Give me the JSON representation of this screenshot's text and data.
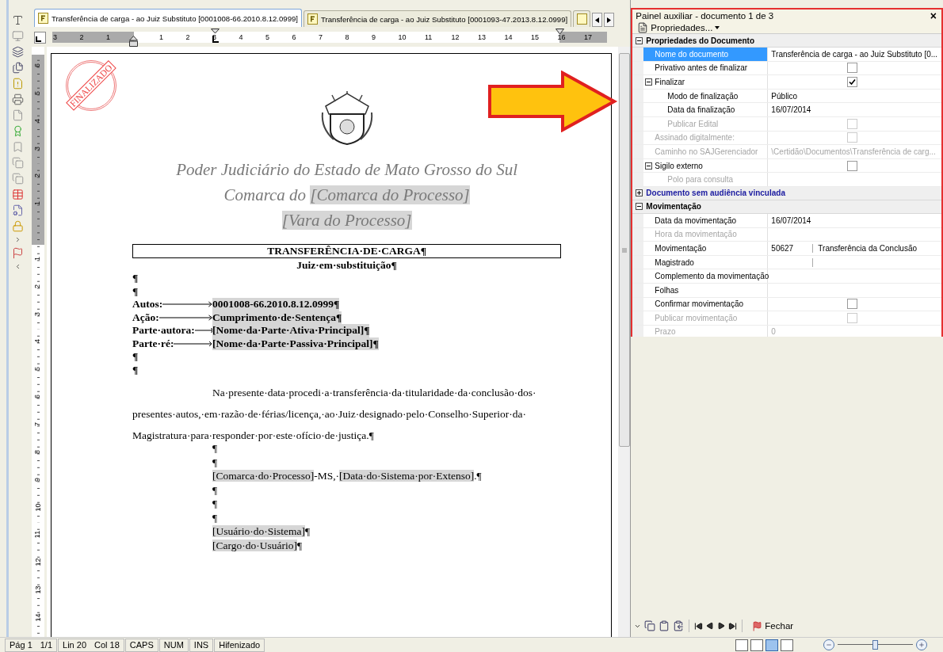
{
  "tabs": [
    {
      "label": "Transferência de carga - ao Juiz Substituto [0001008-66.2010.8.12.0999]",
      "selected": true
    },
    {
      "label": "Transferência de carga - ao Juiz Substituto [0001093-47.2013.8.12.0999]",
      "selected": false
    }
  ],
  "ruler": {
    "left_labels": [
      "3",
      "2",
      "1"
    ],
    "right_labels": [
      "1",
      "2",
      "3",
      "4",
      "5",
      "6",
      "7",
      "8",
      "9",
      "10",
      "11",
      "12",
      "13",
      "14",
      "15",
      "16",
      "17"
    ]
  },
  "vertical_ruler": {
    "upper_labels": [
      "6",
      "5",
      "4",
      "3",
      "2",
      "1"
    ],
    "lower_labels": [
      "1",
      "2",
      "3",
      "4",
      "5",
      "6",
      "7",
      "8",
      "9",
      "10",
      "11",
      "12",
      "13",
      "14"
    ]
  },
  "document": {
    "stamp": "FINALIZADO",
    "header": [
      [
        {
          "text": "Poder Judiciário do Estado de Mato Grosso do Sul",
          "field": false
        }
      ],
      [
        {
          "text": "Comarca do ",
          "field": false
        },
        {
          "text": "[Comarca do Processo]",
          "field": true
        }
      ],
      [
        {
          "text": "[Vara do Processo]",
          "field": true
        }
      ]
    ],
    "title": "TRANSFERÊNCIA·DE·CARGA¶",
    "subtitle": "Juiz·em·substituição¶",
    "marks_before": [
      "¶",
      "¶"
    ],
    "fields": [
      {
        "label": "Autos:",
        "value": "0001008-66.2010.8.12.0999¶"
      },
      {
        "label": "Ação:",
        "value": "Cumprimento·de·Sentença¶"
      },
      {
        "label": "Parte·autora:",
        "value": "[Nome·da·Parte·Ativa·Principal]¶"
      },
      {
        "label": "Parte·ré:",
        "value": "[Nome·da·Parte·Passiva·Principal]¶"
      }
    ],
    "marks_after": [
      "¶",
      "¶"
    ],
    "paragraph": [
      "Na·presente·data·procedi·a·transferência·da·titularidade·da·conclusão·dos·",
      "presentes·autos,·em·razão·de·férias/licença,·ao·Juiz·designado·pelo·Conselho·Superior·da·",
      "Magistratura·para·responder·por·este·ofício·de·justiça.¶"
    ],
    "closing": [
      [
        {
          "text": "¶",
          "field": false
        }
      ],
      [
        {
          "text": "¶",
          "field": false
        }
      ],
      [
        {
          "text": "[Comarca·do·Processo]",
          "field": true
        },
        {
          "text": "-MS,·",
          "field": false
        },
        {
          "text": "[Data·do·Sistema·por·Extenso]",
          "field": true
        },
        {
          "text": ".¶",
          "field": false
        }
      ],
      [
        {
          "text": "¶",
          "field": false
        }
      ],
      [
        {
          "text": "¶",
          "field": false
        }
      ],
      [
        {
          "text": "¶",
          "field": false
        }
      ],
      [
        {
          "text": "[Usuário·do·Sistema]",
          "field": true
        },
        {
          "text": "¶",
          "field": false
        }
      ],
      [
        {
          "text": "[Cargo·do·Usuário]",
          "field": true
        },
        {
          "text": "¶",
          "field": false
        }
      ]
    ]
  },
  "panel": {
    "title": "Painel auxiliar - documento 1 de 3",
    "close": "×",
    "menu": "Propriedades...",
    "groups": [
      {
        "title": "Propriedades do Documento",
        "expanded": true,
        "emphasized": false,
        "rows": [
          {
            "label": "Nome do documento",
            "kind": "text",
            "value": "Transferência de carga - ao Juiz Substituto [0...",
            "selected": true,
            "disabled": false
          },
          {
            "label": "Privativo antes de finalizar",
            "kind": "check",
            "checked": false,
            "selected": false,
            "disabled": false
          },
          {
            "label": "Finalizar",
            "kind": "check",
            "checked": true,
            "selected": false,
            "disabled": false,
            "expanded": true,
            "children": [
              {
                "label": "Modo de finalização",
                "kind": "text",
                "value": "Público",
                "selected": false,
                "disabled": false
              },
              {
                "label": "Data da finalização",
                "kind": "text",
                "value": "16/07/2014",
                "selected": false,
                "disabled": false
              },
              {
                "label": "Publicar Edital",
                "kind": "check",
                "checked": false,
                "selected": false,
                "disabled": true
              }
            ]
          },
          {
            "label": "Assinado digitalmente:",
            "kind": "check",
            "checked": false,
            "selected": false,
            "disabled": true
          },
          {
            "label": "Caminho no SAJGerenciador",
            "kind": "text",
            "value": "\\Certidão\\Documentos\\Transferência de carg...",
            "selected": false,
            "disabled": true
          },
          {
            "label": "Sigilo externo",
            "kind": "check",
            "checked": false,
            "selected": false,
            "disabled": false,
            "expanded": true,
            "children": [
              {
                "label": "Polo para consulta",
                "kind": "text",
                "selected": false,
                "disabled": true
              }
            ]
          }
        ]
      },
      {
        "title": "Documento sem audiência vinculada",
        "expanded": false,
        "emphasized": true
      },
      {
        "title": "Movimentação",
        "expanded": true,
        "emphasized": false,
        "rows": [
          {
            "label": "Data da movimentação",
            "kind": "text",
            "value": "16/07/2014",
            "selected": false,
            "disabled": false
          },
          {
            "label": "Hora da movimentação",
            "kind": "text",
            "selected": false,
            "disabled": true
          },
          {
            "label": "Movimentação",
            "kind": "split",
            "values": [
              "50627",
              "Transferência da Conclusão"
            ],
            "selected": false,
            "disabled": false
          },
          {
            "label": "Magistrado",
            "kind": "split",
            "selected": false,
            "disabled": false
          },
          {
            "label": "Complemento da movimentação",
            "kind": "text",
            "selected": false,
            "disabled": false
          },
          {
            "label": "Folhas",
            "kind": "text",
            "selected": false,
            "disabled": false
          },
          {
            "label": "Confirmar movimentação",
            "kind": "check",
            "checked": false,
            "selected": false,
            "disabled": false
          },
          {
            "label": "Publicar movimentação",
            "kind": "check",
            "checked": false,
            "selected": false,
            "disabled": true
          },
          {
            "label": "Prazo",
            "kind": "text",
            "value": "0",
            "selected": false,
            "disabled": true
          }
        ]
      }
    ],
    "close_button": "Fechar"
  },
  "status_bar": {
    "cells": [
      [
        "Pág 1",
        "1/1"
      ],
      [
        "Lin 20",
        "Col 18"
      ],
      [
        "CAPS"
      ],
      [
        "NUM"
      ],
      [
        "INS"
      ],
      [
        "Hifenizado"
      ]
    ],
    "views": [
      {
        "selected": false
      },
      {
        "selected": false
      },
      {
        "selected": true
      },
      {
        "selected": false
      }
    ],
    "zoom": {
      "level": 0.5
    }
  }
}
